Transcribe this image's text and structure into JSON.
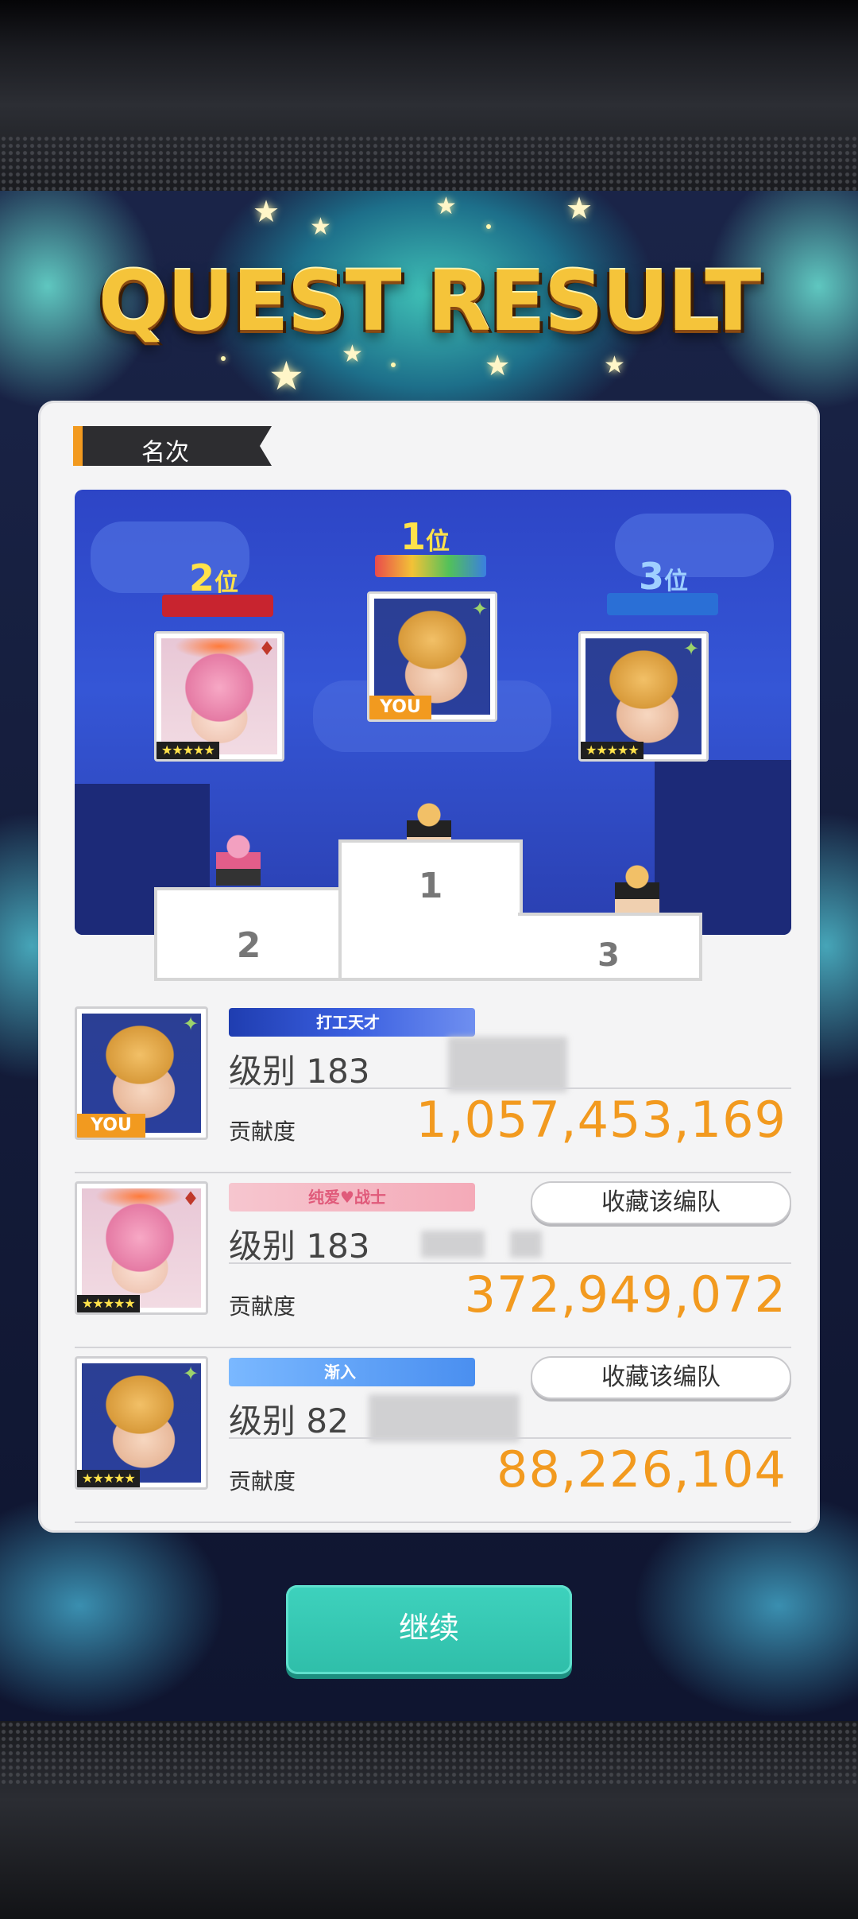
{
  "title": "QUEST RESULT",
  "section": {
    "label": "名次"
  },
  "podium": {
    "first": {
      "rank_num": "1",
      "rank_suffix": "位",
      "tag": "YOU",
      "element": "plus"
    },
    "second": {
      "rank_num": "2",
      "rank_suffix": "位",
      "rarity": "★★★★★",
      "element": "diamond"
    },
    "third": {
      "rank_num": "3",
      "rank_suffix": "位",
      "rarity": "★★★★★",
      "element": "plus"
    },
    "step_labels": [
      "1",
      "2",
      "3"
    ]
  },
  "results": [
    {
      "title_badge": "打工天才",
      "level": "级别 183",
      "contrib_label": "贡献度",
      "score": "1,057,453,169",
      "tag": "YOU",
      "art": "blonde",
      "element": "plus"
    },
    {
      "title_badge": "纯爱♥战士",
      "level": "级别 183",
      "contrib_label": "贡献度",
      "score": "372,949,072",
      "favorite_label": "收藏该编队",
      "rarity": "★★★★★",
      "art": "pink",
      "element": "diamond"
    },
    {
      "title_badge": "渐入",
      "level": "级别 82",
      "contrib_label": "贡献度",
      "score": "88,226,104",
      "favorite_label": "收藏该编队",
      "rarity": "★★★★★",
      "art": "blonde",
      "element": "plus"
    }
  ],
  "continue_label": "继续",
  "colors": {
    "accent_orange": "#f29a1f",
    "button_teal": "#3ed2bd",
    "title_gold": "#f5c43a"
  }
}
